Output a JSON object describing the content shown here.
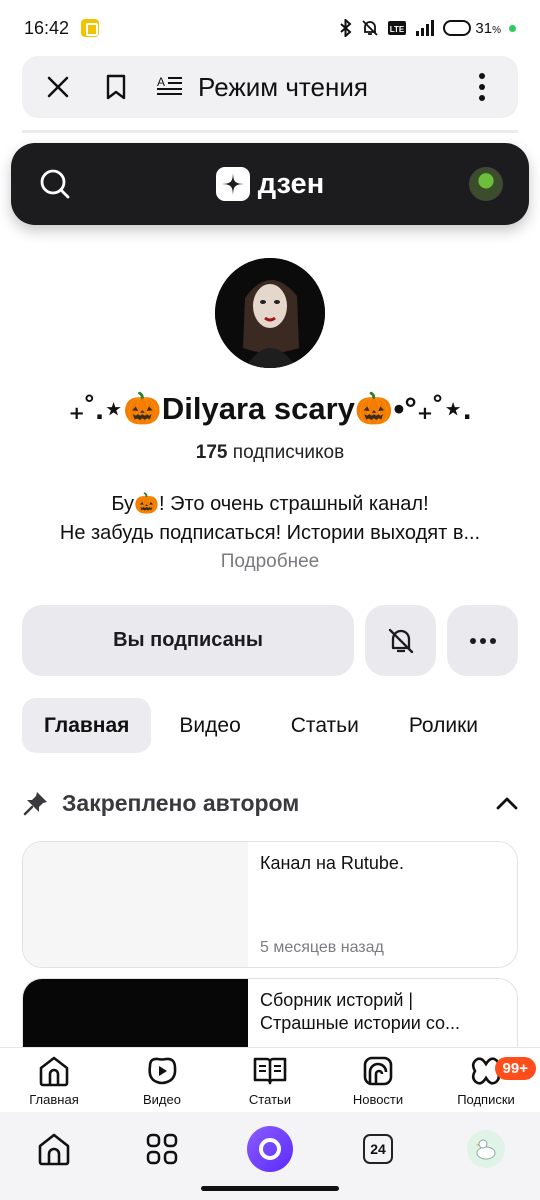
{
  "status_bar": {
    "time": "16:42",
    "battery_percent": "31",
    "battery_unit": "%",
    "battery_level": 0.31
  },
  "reader_bar": {
    "title": "Режим чтения"
  },
  "dzen_header": {
    "logo_text": "дзен"
  },
  "channel": {
    "name": "₊˚.⋆🎃Dilyara scary🎃•°₊˚⋆.",
    "subscribers_count": "175",
    "subscribers_label": "подписчиков",
    "description_line1": "Бу🎃! Это очень страшный канал!",
    "description_line2": "Не забудь подписаться! Истории выходят в...",
    "more_link": "Подробнее"
  },
  "actions": {
    "subscribed_label": "Вы подписаны"
  },
  "tabs": [
    {
      "label": "Главная",
      "active": true
    },
    {
      "label": "Видео",
      "active": false
    },
    {
      "label": "Статьи",
      "active": false
    },
    {
      "label": "Ролики",
      "active": false
    }
  ],
  "pinned": {
    "title": "Закреплено автором",
    "cards": [
      {
        "title": "Канал на Rutube.",
        "date": "5 месяцев назад"
      },
      {
        "title": "Сборник историй | Страшные истории со...",
        "date": ""
      }
    ]
  },
  "bottom_nav": {
    "items": [
      {
        "label": "Главная",
        "icon": "home-icon"
      },
      {
        "label": "Видео",
        "icon": "video-icon"
      },
      {
        "label": "Статьи",
        "icon": "articles-icon"
      },
      {
        "label": "Новости",
        "icon": "news-icon"
      },
      {
        "label": "Подписки",
        "icon": "subscriptions-icon"
      }
    ],
    "subscriptions_badge": "99+"
  },
  "browser_bar": {
    "tabs_count": "24"
  }
}
